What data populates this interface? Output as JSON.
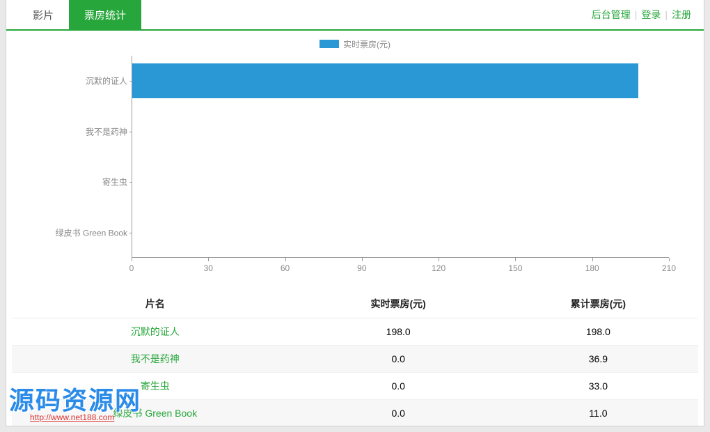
{
  "nav": {
    "tab_movies": "影片",
    "tab_stats": "票房统计",
    "link_admin": "后台管理",
    "link_login": "登录",
    "link_register": "注册",
    "sep": "|"
  },
  "legend_label": "实时票房(元)",
  "chart_data": {
    "type": "bar",
    "orientation": "horizontal",
    "categories": [
      "沉默的证人",
      "我不是药神",
      "寄生虫",
      "绿皮书 Green Book"
    ],
    "values": [
      198.0,
      0.0,
      0.0,
      0.0
    ],
    "x_ticks": [
      0,
      30,
      60,
      90,
      120,
      150,
      180,
      210
    ],
    "xlim": [
      0,
      210
    ],
    "title": "",
    "xlabel": "",
    "ylabel": "",
    "series_name": "实时票房(元)",
    "bar_color": "#2b98d6"
  },
  "table": {
    "headers": [
      "片名",
      "实时票房(元)",
      "累计票房(元)"
    ],
    "rows": [
      {
        "name": "沉默的证人",
        "realtime": "198.0",
        "total": "198.0"
      },
      {
        "name": "我不是药神",
        "realtime": "0.0",
        "total": "36.9"
      },
      {
        "name": "寄生虫",
        "realtime": "0.0",
        "total": "33.0"
      },
      {
        "name": "绿皮书 Green Book",
        "realtime": "0.0",
        "total": "11.0"
      }
    ]
  },
  "watermark": {
    "text": "源码资源网",
    "url": "http://www.net188.com"
  }
}
